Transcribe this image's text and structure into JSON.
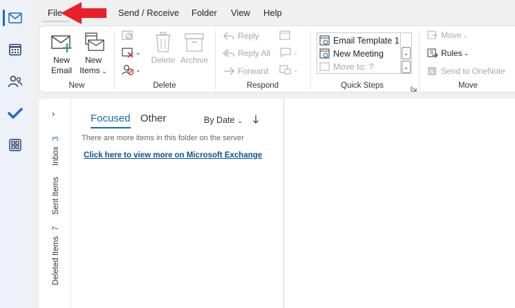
{
  "menu": {
    "file": "File",
    "send_receive": "Send / Receive",
    "folder": "Folder",
    "view": "View",
    "help": "Help"
  },
  "ribbon": {
    "new_group": {
      "label": "New",
      "new_email": "New Email",
      "new_email_l1": "New",
      "new_email_l2": "Email",
      "new_items_l1": "New",
      "new_items_l2": "Items"
    },
    "delete_group": {
      "label": "Delete",
      "delete": "Delete",
      "archive": "Archive"
    },
    "respond_group": {
      "label": "Respond",
      "reply": "Reply",
      "reply_all": "Reply All",
      "forward": "Forward"
    },
    "quick_steps_group": {
      "label": "Quick Steps",
      "items": [
        "Email Template 1",
        "New Meeting",
        "Move to: ?"
      ]
    },
    "move_group": {
      "label": "Move",
      "move": "Move",
      "rules": "Rules",
      "send_onenote": "Send to OneNote"
    }
  },
  "folders": [
    {
      "name": "Inbox",
      "count": "3"
    },
    {
      "name": "Sent Items",
      "count": ""
    },
    {
      "name": "Deleted Items",
      "count": "7"
    }
  ],
  "message_list": {
    "tab_focused": "Focused",
    "tab_other": "Other",
    "sort": "By Date",
    "info": "There are more items in this folder on the server",
    "link": "Click here to view more on Microsoft Exchange"
  },
  "colors": {
    "accent": "#0f6cbd",
    "arrow": "#e8202a"
  }
}
